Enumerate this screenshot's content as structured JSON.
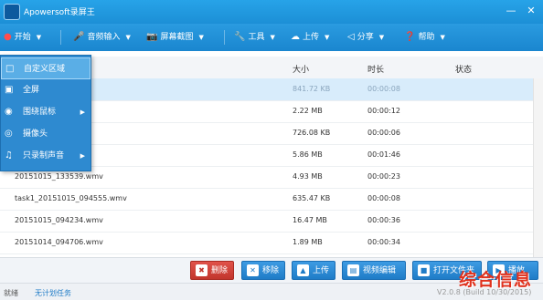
{
  "window": {
    "title": "Apowersoft录屏王"
  },
  "toolbar": {
    "items": [
      {
        "label": "开始"
      },
      {
        "label": "音频输入"
      },
      {
        "label": "屏幕截图"
      },
      {
        "label": "工具"
      },
      {
        "label": "上传"
      },
      {
        "label": "分享"
      },
      {
        "label": "帮助"
      }
    ]
  },
  "table": {
    "headers": [
      "大小",
      "时长",
      "状态"
    ],
    "rows": [
      {
        "name": "",
        "size": "841.72 KB",
        "duration": "00:00:08",
        "status": ""
      },
      {
        "name": "",
        "size": "2.22 MB",
        "duration": "00:00:12",
        "status": ""
      },
      {
        "name": "",
        "size": "726.08 KB",
        "duration": "00:00:06",
        "status": ""
      },
      {
        "name": "",
        "size": "5.86 MB",
        "duration": "00:01:46",
        "status": ""
      },
      {
        "name": "20151015_133539.wmv",
        "size": "4.93 MB",
        "duration": "00:00:23",
        "status": ""
      },
      {
        "name": "task1_20151015_094555.wmv",
        "size": "635.47 KB",
        "duration": "00:00:08",
        "status": ""
      },
      {
        "name": "20151015_094234.wmv",
        "size": "16.47 MB",
        "duration": "00:00:36",
        "status": ""
      },
      {
        "name": "20151014_094706.wmv",
        "size": "1.89 MB",
        "duration": "00:00:34",
        "status": ""
      }
    ]
  },
  "dropdown_menu": {
    "items": [
      {
        "label": "自定义区域"
      },
      {
        "label": "全屏"
      },
      {
        "label": "围绕鼠标"
      },
      {
        "label": "摄像头"
      },
      {
        "label": "只录制声音"
      }
    ]
  },
  "actions": {
    "delete": "删除",
    "remove": "移除",
    "upload": "上传",
    "edit_video": "视频编辑",
    "open_folder": "打开文件夹",
    "play": "播放"
  },
  "status": {
    "left": "就绪",
    "task_plan": "无计划任务",
    "version": "V2.0.8 (Build 10/30/2015)"
  },
  "watermark": "综合信息",
  "colors": {
    "accent": "#1f8ad6",
    "selection": "#d8ecfb",
    "delete": "#c2362d"
  }
}
